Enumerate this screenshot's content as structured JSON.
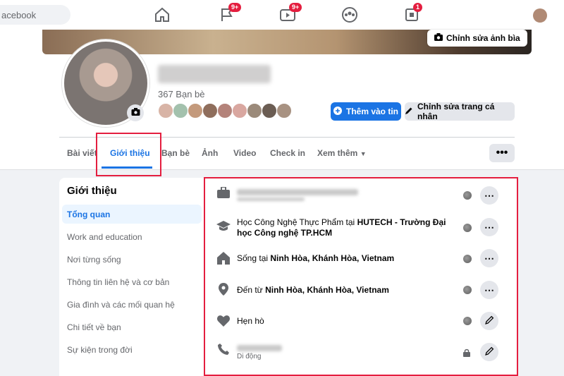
{
  "topbar": {
    "search_placeholder": "acebook",
    "badges": {
      "flag": "9+",
      "video": "9+",
      "gaming": "1"
    }
  },
  "cover": {
    "edit_label": "Chỉnh sửa ảnh bìa"
  },
  "profile": {
    "friends_count": "367 Bạn bè",
    "add_story_label": "Thêm vào tin",
    "edit_profile_label": "Chỉnh sửa trang cá nhân"
  },
  "tabs": [
    {
      "label": "Bài viết"
    },
    {
      "label": "Giới thiệu"
    },
    {
      "label": "Bạn bè"
    },
    {
      "label": "Ảnh"
    },
    {
      "label": "Video"
    },
    {
      "label": "Check in"
    },
    {
      "label": "Xem thêm"
    }
  ],
  "about_nav": {
    "title": "Giới thiệu",
    "items": [
      "Tổng quan",
      "Work and education",
      "Nơi từng sống",
      "Thông tin liên hệ và cơ bản",
      "Gia đình và các mối quan hệ",
      "Chi tiết về bạn",
      "Sự kiện trong đời"
    ]
  },
  "overview": {
    "education": {
      "prefix": "Học Công Nghệ Thực Phẩm tại ",
      "school": "HUTECH - Trường Đại học Công nghệ TP.HCM"
    },
    "lives": {
      "prefix": "Sống tại ",
      "place": "Ninh Hòa, Khánh Hòa, Vietnam"
    },
    "from": {
      "prefix": "Đến từ ",
      "place": "Ninh Hòa, Khánh Hòa, Vietnam"
    },
    "dating": {
      "label": "Hẹn hò"
    },
    "phone": {
      "sublabel": "Di động"
    }
  },
  "colors": {
    "accent": "#1b74e4",
    "highlight": "#e41e3f"
  }
}
